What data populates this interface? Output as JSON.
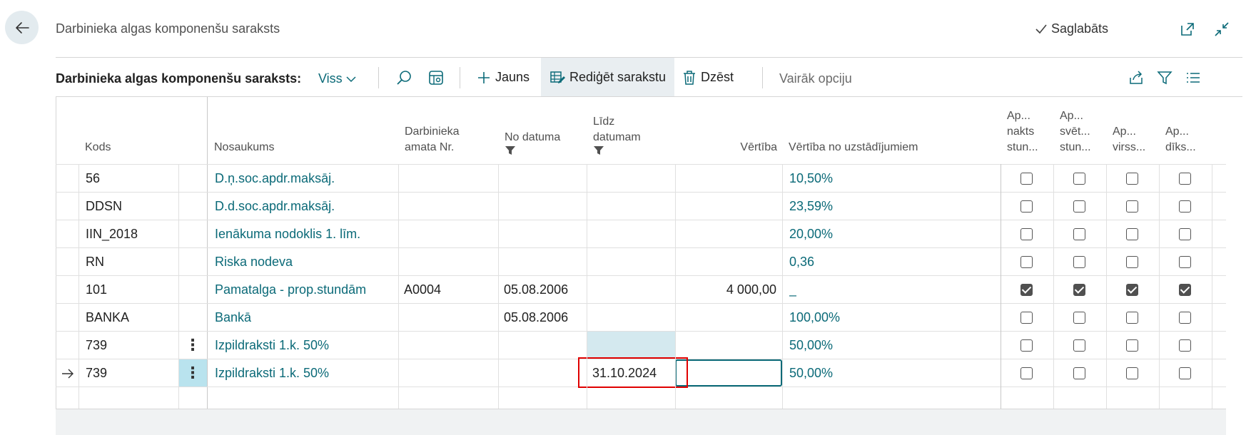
{
  "header": {
    "title": "Darbinieka algas komponenšu saraksts",
    "saved_label": "Saglabāts"
  },
  "toolbar": {
    "list_title": "Darbinieka algas komponenšu saraksts:",
    "view": "Viss",
    "new_label": "Jauns",
    "edit_list_label": "Rediģēt sarakstu",
    "delete_label": "Dzēst",
    "more_label": "Vairāk opciju"
  },
  "columns": {
    "kods": "Kods",
    "nosaukums": "Nosaukums",
    "amata_line1": "Darbinieka",
    "amata_line2": "amata Nr.",
    "no_datuma": "No datuma",
    "lidz_line1": "Līdz",
    "lidz_line2": "datumam",
    "vertiba": "Vērtība",
    "vertiba_no": "Vērtība no uzstādījumiem",
    "ap1_line1": "Ap...",
    "ap1_line2": "nakts",
    "ap1_line3": "stun...",
    "ap2_line1": "Ap...",
    "ap2_line2": "svēt...",
    "ap2_line3": "stun...",
    "ap3_line1": "Ap...",
    "ap3_line2": "virss...",
    "ap4_line1": "Ap...",
    "ap4_line2": "dīks..."
  },
  "rows": [
    {
      "kods": "56",
      "nosaukums": "D.ņ.soc.apdr.maksāj.",
      "amata": "",
      "no": "",
      "lidz": "",
      "vertiba": "",
      "vertiba_no": "10,50%",
      "checks": [
        false,
        false,
        false,
        false
      ]
    },
    {
      "kods": "DDSN",
      "nosaukums": "D.d.soc.apdr.maksāj.",
      "amata": "",
      "no": "",
      "lidz": "",
      "vertiba": "",
      "vertiba_no": "23,59%",
      "checks": [
        false,
        false,
        false,
        false
      ]
    },
    {
      "kods": "IIN_2018",
      "nosaukums": "Ienākuma nodoklis 1. līm.",
      "amata": "",
      "no": "",
      "lidz": "",
      "vertiba": "",
      "vertiba_no": "20,00%",
      "checks": [
        false,
        false,
        false,
        false
      ]
    },
    {
      "kods": "RN",
      "nosaukums": "Riska nodeva",
      "amata": "",
      "no": "",
      "lidz": "",
      "vertiba": "",
      "vertiba_no": "0,36",
      "checks": [
        false,
        false,
        false,
        false
      ]
    },
    {
      "kods": "101",
      "nosaukums": "Pamatalga - prop.stundām",
      "amata": "A0004",
      "no": "05.08.2006",
      "lidz": "",
      "vertiba": "4 000,00",
      "vertiba_no": "_",
      "checks": [
        true,
        true,
        true,
        true
      ]
    },
    {
      "kods": "BANKA",
      "nosaukums": "Bankā",
      "amata": "",
      "no": "05.08.2006",
      "lidz": "",
      "vertiba": "",
      "vertiba_no": "100,00%",
      "checks": [
        false,
        false,
        false,
        false
      ]
    },
    {
      "kods": "739",
      "nosaukums": "Izpildraksti 1.k. 50%",
      "amata": "",
      "no": "",
      "lidz": "",
      "vertiba": "",
      "vertiba_no": "50,00%",
      "checks": [
        false,
        false,
        false,
        false
      ]
    },
    {
      "kods": "739",
      "nosaukums": "Izpildraksti 1.k. 50%",
      "amata": "",
      "no": "",
      "lidz": "31.10.2024",
      "vertiba": "",
      "vertiba_no": "50,00%",
      "checks": [
        false,
        false,
        false,
        false
      ]
    }
  ],
  "colors": {
    "accent": "#0b6a78",
    "selection": "#b9e3ee",
    "highlight_red": "#e00000"
  }
}
